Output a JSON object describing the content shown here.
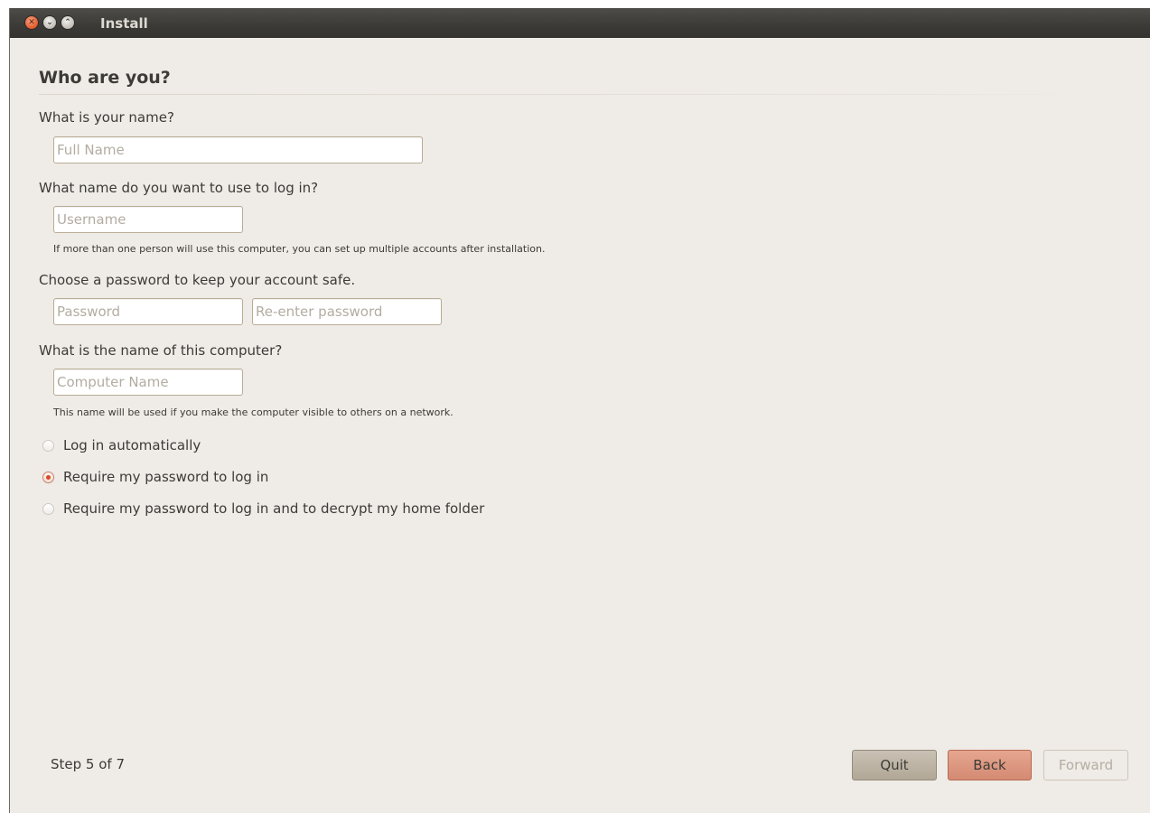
{
  "window": {
    "title": "Install"
  },
  "page": {
    "heading": "Who are you?"
  },
  "name_section": {
    "label": "What is your name?",
    "placeholder": "Full Name",
    "value": ""
  },
  "login_section": {
    "label": "What name do you want to use to log in?",
    "placeholder": "Username",
    "value": "",
    "hint": "If more than one person will use this computer, you can set up multiple accounts after installation."
  },
  "password_section": {
    "label": "Choose a password to keep your account safe.",
    "password_placeholder": "Password",
    "confirm_placeholder": "Re-enter password"
  },
  "computer_section": {
    "label": "What is the name of this computer?",
    "placeholder": "Computer Name",
    "value": "",
    "hint": "This name will be used if you make the computer visible to others on a network."
  },
  "login_options": [
    {
      "label": "Log in automatically",
      "selected": false
    },
    {
      "label": "Require my password to log in",
      "selected": true
    },
    {
      "label": "Require my password to log in and to decrypt my home folder",
      "selected": false
    }
  ],
  "footer": {
    "step_text": "Step 5 of 7",
    "quit_label": "Quit",
    "back_label": "Back",
    "forward_label": "Forward",
    "forward_enabled": false
  },
  "colors": {
    "background": "#efebe6",
    "titlebar": "#3b3a37",
    "accent_radio": "#d9482a",
    "back_button": "#d48a73"
  }
}
